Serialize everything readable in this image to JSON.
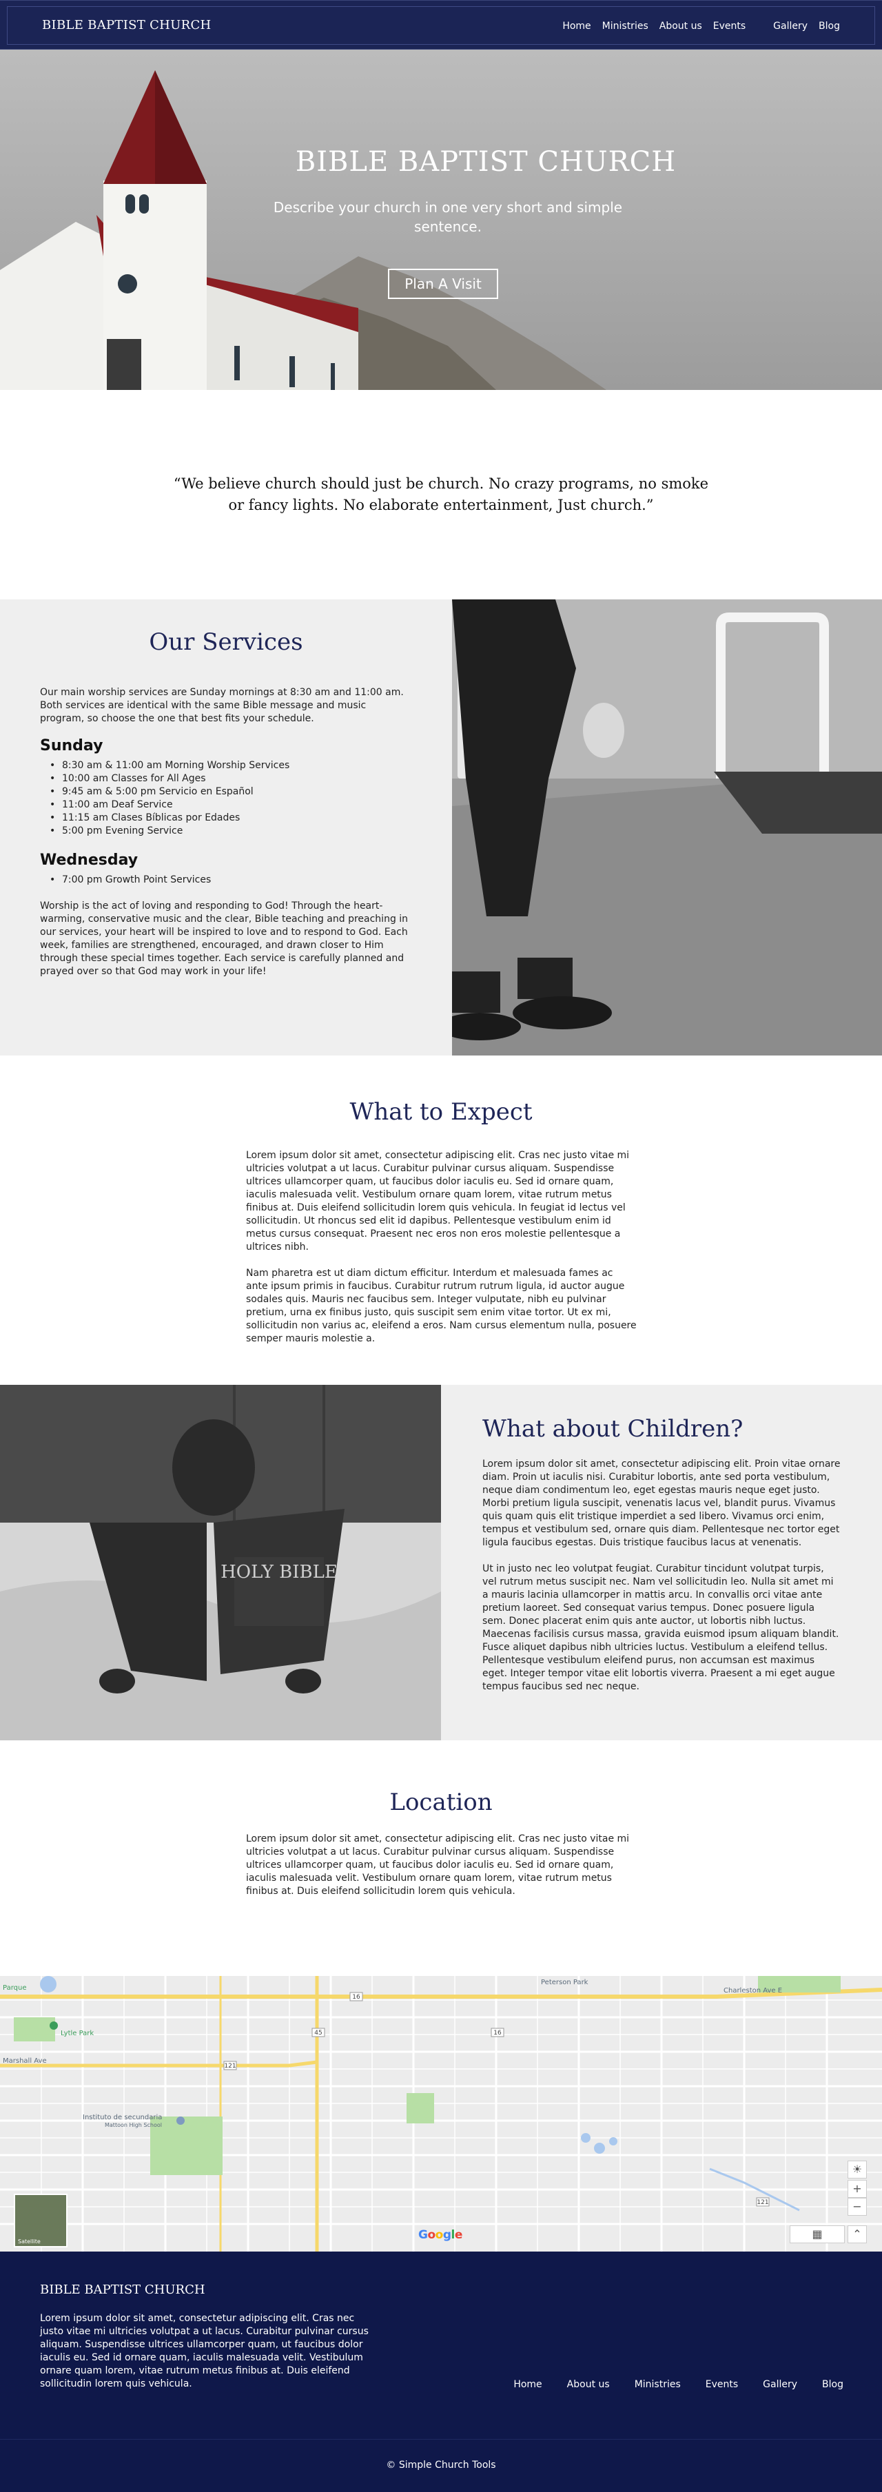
{
  "nav": {
    "brand": "BIBLE BAPTIST CHURCH",
    "links": [
      "Home",
      "Ministries",
      "About us",
      "Events",
      "Gallery",
      "Blog"
    ]
  },
  "hero": {
    "title": "BIBLE BAPTIST CHURCH",
    "subtitle": "Describe your church in one very short and simple sentence.",
    "cta": "Plan A Visit"
  },
  "quote": "“We believe church should just be church.  No crazy programs, no smoke or fancy lights.  No elaborate entertainment, Just church.”",
  "services": {
    "title": "Our Services",
    "intro": "Our main worship services are Sunday mornings at 8:30 am and 11:00 am. Both services are identical with the same Bible message and music program, so choose the one that best fits your schedule.",
    "sunday_label": "Sunday",
    "sunday_items": [
      "8:30 am & 11:00 am Morning Worship Services",
      "10:00 am Classes for All Ages",
      "9:45 am & 5:00 pm Servicio en Español",
      "11:00 am Deaf Service",
      "11:15 am Clases Bíblicas por Edades",
      "5:00 pm Evening Service"
    ],
    "wednesday_label": "Wednesday",
    "wednesday_items": [
      "7:00 pm Growth Point Services"
    ],
    "outro": "Worship is the act of loving and responding to God! Through the heart-warming, conservative music and the clear, Bible teaching and preaching in our services, your heart will be inspired to love and to respond to God. Each week, families are strengthened, encouraged, and drawn closer to Him through these special times together. Each service is carefully planned and prayed over so that God may work in your life!"
  },
  "expect": {
    "title": "What to Expect",
    "p1": "Lorem ipsum dolor sit amet, consectetur adipiscing elit. Cras nec justo vitae mi ultricies volutpat a ut lacus. Curabitur pulvinar cursus aliquam. Suspendisse ultrices ullamcorper quam, ut faucibus dolor iaculis eu. Sed id ornare quam, iaculis malesuada velit. Vestibulum ornare quam lorem, vitae rutrum metus finibus at. Duis eleifend sollicitudin lorem quis vehicula. In feugiat id lectus vel sollicitudin. Ut rhoncus sed elit id dapibus. Pellentesque vestibulum enim id metus cursus consequat. Praesent nec eros non eros molestie pellentesque a ultrices nibh.",
    "p2": "Nam pharetra est ut diam dictum efficitur. Interdum et malesuada fames ac ante ipsum primis in faucibus. Curabitur rutrum rutrum ligula, id auctor augue sodales quis. Mauris nec faucibus sem. Integer vulputate, nibh eu pulvinar pretium, urna ex finibus justo, quis suscipit sem enim vitae tortor. Ut ex mi, sollicitudin non varius ac, eleifend a eros. Nam cursus elementum nulla, posuere semper mauris molestie a."
  },
  "children": {
    "title": "What about Children?",
    "book_title": "HOLY BIBLE",
    "p1": "Lorem ipsum dolor sit amet, consectetur adipiscing elit. Proin vitae ornare diam. Proin ut iaculis nisi. Curabitur lobortis, ante sed porta vestibulum, neque diam condimentum leo, eget egestas mauris neque eget justo. Morbi pretium ligula suscipit, venenatis lacus vel, blandit purus. Vivamus quis quam quis elit tristique imperdiet a sed libero. Vivamus orci enim, tempus et vestibulum sed, ornare quis diam. Pellentesque nec tortor eget ligula faucibus egestas. Duis tristique faucibus lacus at venenatis.",
    "p2": "Ut in justo nec leo volutpat feugiat. Curabitur tincidunt volutpat turpis, vel rutrum metus suscipit nec. Nam vel sollicitudin leo. Nulla sit amet mi a mauris lacinia ullamcorper in mattis arcu. In convallis orci vitae ante pretium laoreet. Sed consequat varius tempus. Donec posuere ligula sem. Donec placerat enim quis ante auctor, ut lobortis nibh luctus. Maecenas facilisis cursus massa, gravida euismod ipsum aliquam blandit. Fusce aliquet dapibus nibh ultricies luctus. Vestibulum a eleifend tellus. Pellentesque vestibulum eleifend purus, non accumsan est maximus eget. Integer tempor vitae elit lobortis viverra. Praesent a mi eget augue tempus faucibus sed nec neque."
  },
  "location": {
    "title": "Location",
    "body": "Lorem ipsum dolor sit amet, consectetur adipiscing elit. Cras nec justo vitae mi ultricies volutpat a ut lacus. Curabitur pulvinar cursus aliquam. Suspendisse ultrices ullamcorper quam, ut faucibus dolor iaculis eu. Sed id ornare quam, iaculis malesuada velit. Vestibulum ornare quam lorem, vitae rutrum metus finibus at. Duis eleifend sollicitudin lorem quis vehicula."
  },
  "map": {
    "labels": {
      "park": "Peterson Park",
      "parque": "Parque",
      "lytle": "Lytle Park",
      "marshall": "Marshall Ave",
      "charleston": "Charleston Ave E",
      "school": "Instituto de secundaria",
      "school_sub": "Mattoon High School"
    },
    "route_badges": [
      "16",
      "45",
      "16",
      "45",
      "121",
      "16",
      "121"
    ],
    "zoom_in": "+",
    "zoom_out": "−",
    "thumb_label": "Satellite",
    "google": "Google"
  },
  "footer": {
    "brand": "BIBLE BAPTIST CHURCH",
    "text": "Lorem ipsum dolor sit amet, consectetur adipiscing elit. Cras nec justo vitae mi ultricies volutpat a ut lacus. Curabitur pulvinar cursus aliquam. Suspendisse ultrices ullamcorper quam, ut faucibus dolor iaculis eu. Sed id ornare quam, iaculis malesuada velit. Vestibulum ornare quam lorem, vitae rutrum metus finibus at. Duis eleifend sollicitudin lorem quis vehicula.",
    "links": [
      "Home",
      "About us",
      "Ministries",
      "Events",
      "Gallery",
      "Blog"
    ],
    "copyright": "© Simple Church Tools"
  },
  "colors": {
    "navy": "#1b2455",
    "footer_navy": "#0f184a",
    "heading": "#1e2557",
    "section_gray": "#efefef"
  }
}
